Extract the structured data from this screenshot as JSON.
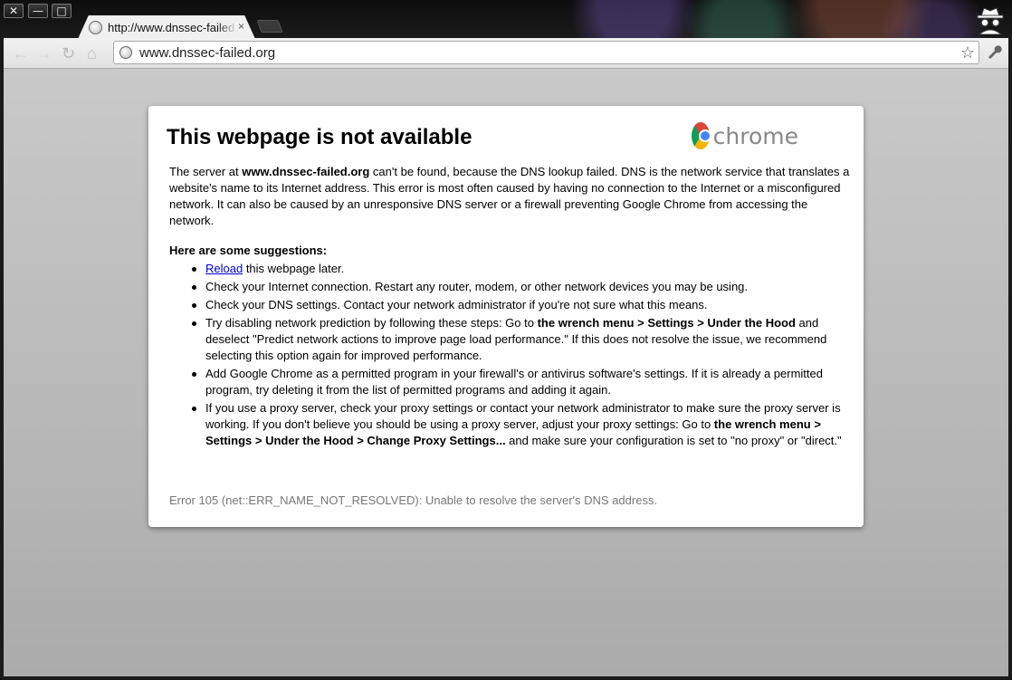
{
  "window": {
    "close_glyph": "✕",
    "minimize_glyph": "—",
    "maximize_glyph": "□"
  },
  "tab": {
    "title": "http://www.dnssec-failed.org",
    "close_glyph": "×"
  },
  "toolbar": {
    "back_glyph": "←",
    "forward_glyph": "→",
    "reload_glyph": "↻",
    "home_glyph": "⌂",
    "url": "www.dnssec-failed.org",
    "star_glyph": "☆",
    "wrench_glyph": "🔧"
  },
  "icons": {
    "tab_favicon": "globe-icon",
    "omnibox": "globe-icon",
    "incognito": "incognito-icon",
    "logo": "chrome-logo"
  },
  "error_page": {
    "title": "This webpage is not available",
    "logo_text": "chrome",
    "desc_pre": "The server at ",
    "desc_host": "www.dnssec-failed.org",
    "desc_post": " can't be found, because the DNS lookup failed. DNS is the network service that translates a website's name to its Internet address. This error is most often caused by having no connection to the Internet or a misconfigured network. It can also be caused by an unresponsive DNS server or a firewall preventing Google Chrome from accessing the network.",
    "suggestions_title": "Here are some suggestions:",
    "s1_link": "Reload",
    "s1_rest": " this webpage later.",
    "s2": "Check your Internet connection. Restart any router, modem, or other network devices you may be using.",
    "s3": "Check your DNS settings. Contact your network administrator if you're not sure what this means.",
    "s4_pre": "Try disabling network prediction by following these steps: Go to ",
    "s4_bold": "the wrench menu > Settings > Under the Hood",
    "s4_post": " and deselect \"Predict network actions to improve page load performance.\" If this does not resolve the issue, we recommend selecting this option again for improved performance.",
    "s5": "Add Google Chrome as a permitted program in your firewall's or antivirus software's settings. If it is already a permitted program, try deleting it from the list of permitted programs and adding it again.",
    "s6_pre": "If you use a proxy server, check your proxy settings or contact your network administrator to make sure the proxy server is working. If you don't believe you should be using a proxy server, adjust your proxy settings: Go to ",
    "s6_bold": "the wrench menu > Settings > Under the Hood > Change Proxy Settings...",
    "s6_post": " and make sure your configuration is set to \"no proxy\" or \"direct.\"",
    "error_code": "Error 105 (net::ERR_NAME_NOT_RESOLVED): Unable to resolve the server's DNS address."
  }
}
